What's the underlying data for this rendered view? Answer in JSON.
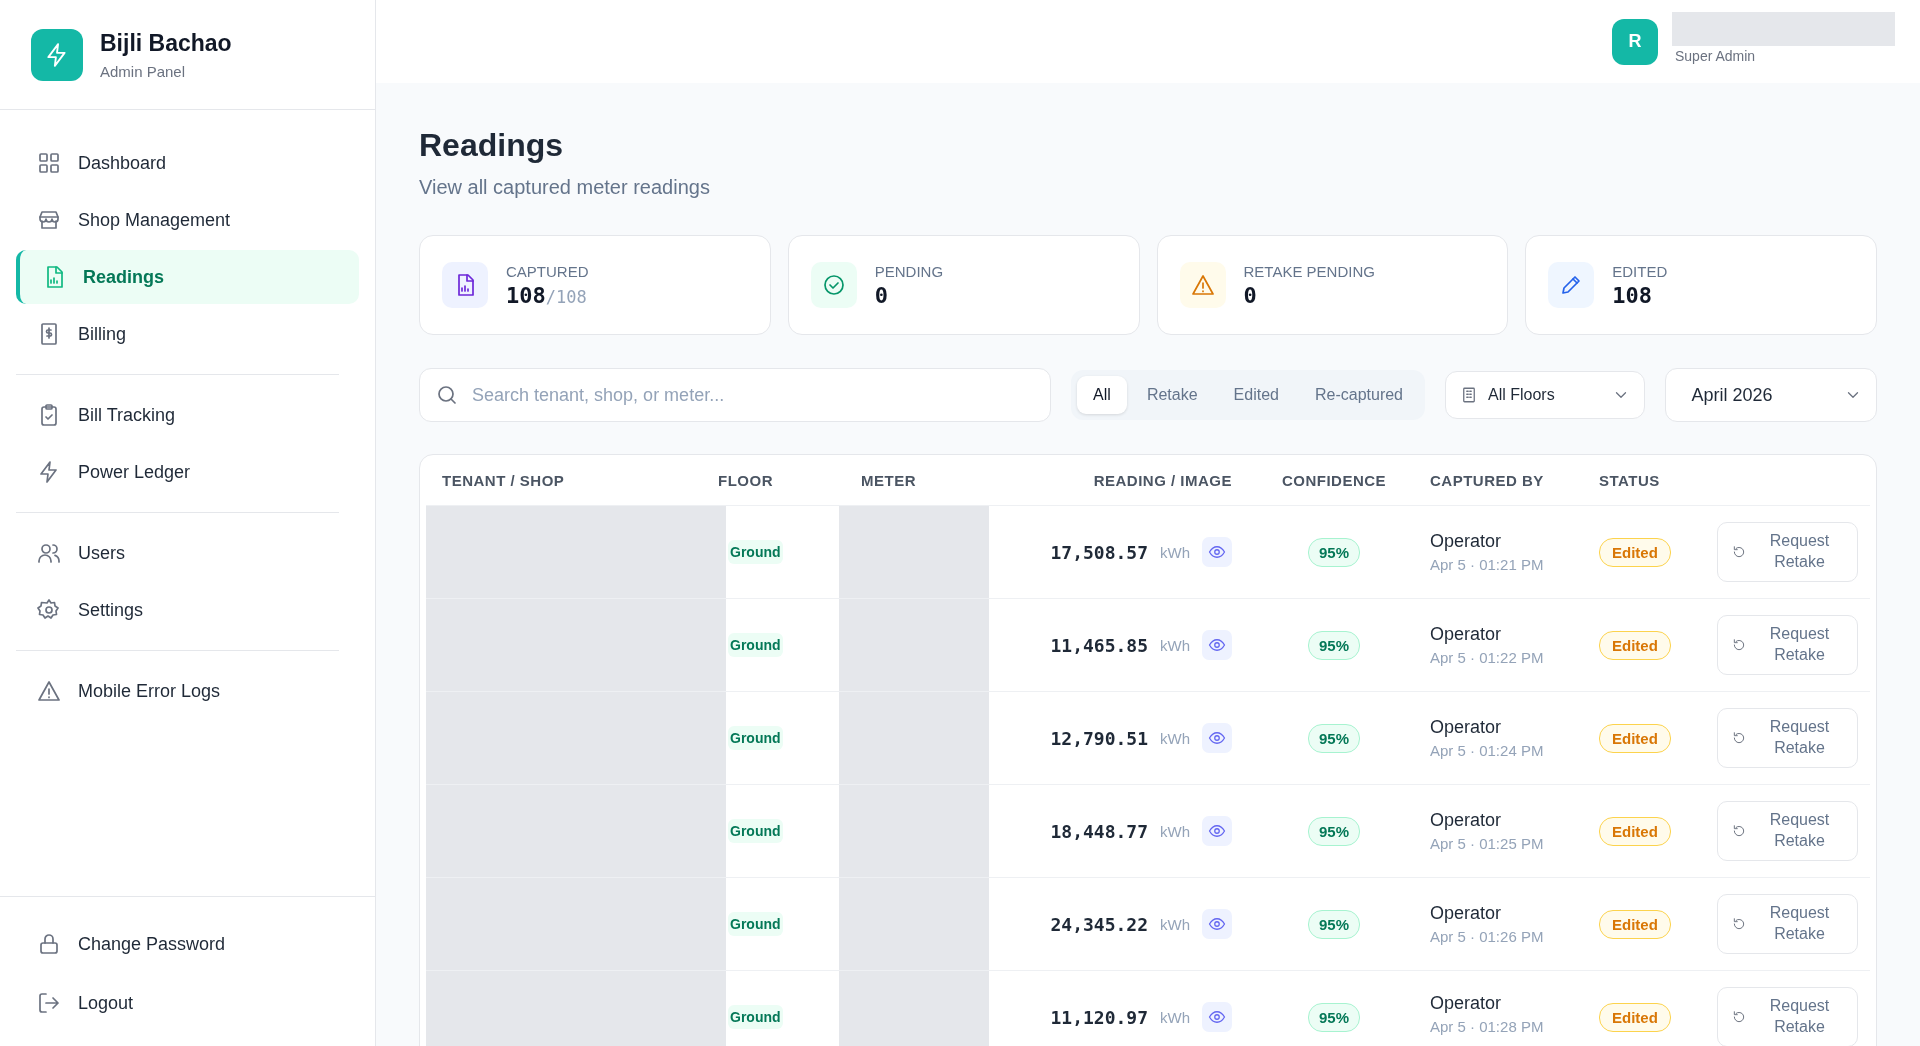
{
  "brand": {
    "name": "Bijli Bachao",
    "subtitle": "Admin Panel"
  },
  "user": {
    "initial": "R",
    "role": "Super Admin"
  },
  "sidebar": {
    "groups": [
      {
        "items": [
          {
            "label": "Dashboard",
            "selected": false
          },
          {
            "label": "Shop Management",
            "selected": false
          },
          {
            "label": "Readings",
            "selected": true
          },
          {
            "label": "Billing",
            "selected": false
          }
        ]
      },
      {
        "items": [
          {
            "label": "Bill Tracking",
            "selected": false
          },
          {
            "label": "Power Ledger",
            "selected": false
          }
        ]
      },
      {
        "items": [
          {
            "label": "Users",
            "selected": false
          },
          {
            "label": "Settings",
            "selected": false
          }
        ]
      },
      {
        "items": [
          {
            "label": "Mobile Error Logs",
            "selected": false
          }
        ]
      }
    ],
    "footer": [
      {
        "label": "Change Password"
      },
      {
        "label": "Logout"
      }
    ]
  },
  "page": {
    "title": "Readings",
    "subtitle": "View all captured meter readings"
  },
  "stats": [
    {
      "kind": "captured",
      "label": "CAPTURED",
      "value": "108",
      "total": "/108"
    },
    {
      "kind": "pending",
      "label": "PENDING",
      "value": "0"
    },
    {
      "kind": "retake",
      "label": "RETAKE PENDING",
      "value": "0"
    },
    {
      "kind": "edited",
      "label": "EDITED",
      "value": "108"
    }
  ],
  "filters": {
    "search": {
      "placeholder": "Search tenant, shop, or meter..."
    },
    "tabs": [
      {
        "label": "All",
        "selected": true
      },
      {
        "label": "Retake",
        "selected": false
      },
      {
        "label": "Edited",
        "selected": false
      },
      {
        "label": "Re-captured",
        "selected": false
      }
    ],
    "floor": "All Floors",
    "month": "April 2026"
  },
  "table": {
    "columns": [
      "TENANT / SHOP",
      "FLOOR",
      "METER",
      "READING / IMAGE",
      "CONFIDENCE",
      "CAPTURED BY",
      "STATUS"
    ],
    "rows": [
      {
        "floor": "Ground",
        "reading": "17,508.57",
        "unit": "kWh",
        "confidence": "95%",
        "captured_by": "Operator",
        "time": "Apr 5 · 01:21 PM",
        "status": "Edited",
        "action": "Request Retake"
      },
      {
        "floor": "Ground",
        "reading": "11,465.85",
        "unit": "kWh",
        "confidence": "95%",
        "captured_by": "Operator",
        "time": "Apr 5 · 01:22 PM",
        "status": "Edited",
        "action": "Request Retake"
      },
      {
        "floor": "Ground",
        "reading": "12,790.51",
        "unit": "kWh",
        "confidence": "95%",
        "captured_by": "Operator",
        "time": "Apr 5 · 01:24 PM",
        "status": "Edited",
        "action": "Request Retake"
      },
      {
        "floor": "Ground",
        "reading": "18,448.77",
        "unit": "kWh",
        "confidence": "95%",
        "captured_by": "Operator",
        "time": "Apr 5 · 01:25 PM",
        "status": "Edited",
        "action": "Request Retake"
      },
      {
        "floor": "Ground",
        "reading": "24,345.22",
        "unit": "kWh",
        "confidence": "95%",
        "captured_by": "Operator",
        "time": "Apr 5 · 01:26 PM",
        "status": "Edited",
        "action": "Request Retake"
      },
      {
        "floor": "Ground",
        "reading": "11,120.97",
        "unit": "kWh",
        "confidence": "95%",
        "captured_by": "Operator",
        "time": "Apr 5 · 01:28 PM",
        "status": "Edited",
        "action": "Request Retake"
      }
    ]
  }
}
